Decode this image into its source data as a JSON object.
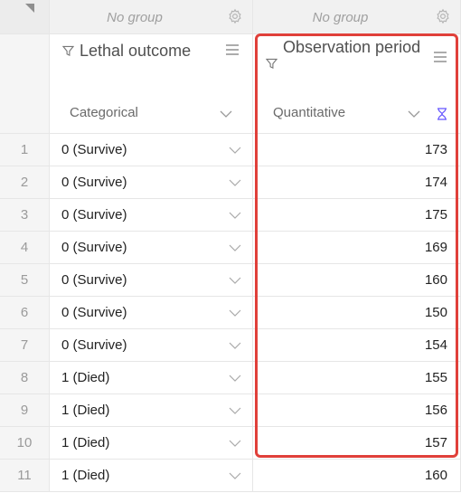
{
  "groups": {
    "col1_label": "No group",
    "col2_label": "No group"
  },
  "columns": [
    {
      "title": "Lethal outcome",
      "type": "Categorical"
    },
    {
      "title": "Observation period",
      "type": "Quantitative"
    }
  ],
  "rows": [
    {
      "num": "1",
      "outcome": "0 (Survive)",
      "period": "173"
    },
    {
      "num": "2",
      "outcome": "0 (Survive)",
      "period": "174"
    },
    {
      "num": "3",
      "outcome": "0 (Survive)",
      "period": "175"
    },
    {
      "num": "4",
      "outcome": "0 (Survive)",
      "period": "169"
    },
    {
      "num": "5",
      "outcome": "0 (Survive)",
      "period": "160"
    },
    {
      "num": "6",
      "outcome": "0 (Survive)",
      "period": "150"
    },
    {
      "num": "7",
      "outcome": "0 (Survive)",
      "period": "154"
    },
    {
      "num": "8",
      "outcome": "1 (Died)",
      "period": "155"
    },
    {
      "num": "9",
      "outcome": "1 (Died)",
      "period": "156"
    },
    {
      "num": "10",
      "outcome": "1 (Died)",
      "period": "157"
    },
    {
      "num": "11",
      "outcome": "1 (Died)",
      "period": "160"
    }
  ],
  "colors": {
    "highlight": "#e0403a",
    "hourglass": "#6b5cff"
  },
  "icons": {
    "filter": "filter-icon",
    "menu": "menu-icon",
    "settings": "gear-icon",
    "dropdown": "chevron-down-icon",
    "sort_pending": "hourglass-icon"
  }
}
